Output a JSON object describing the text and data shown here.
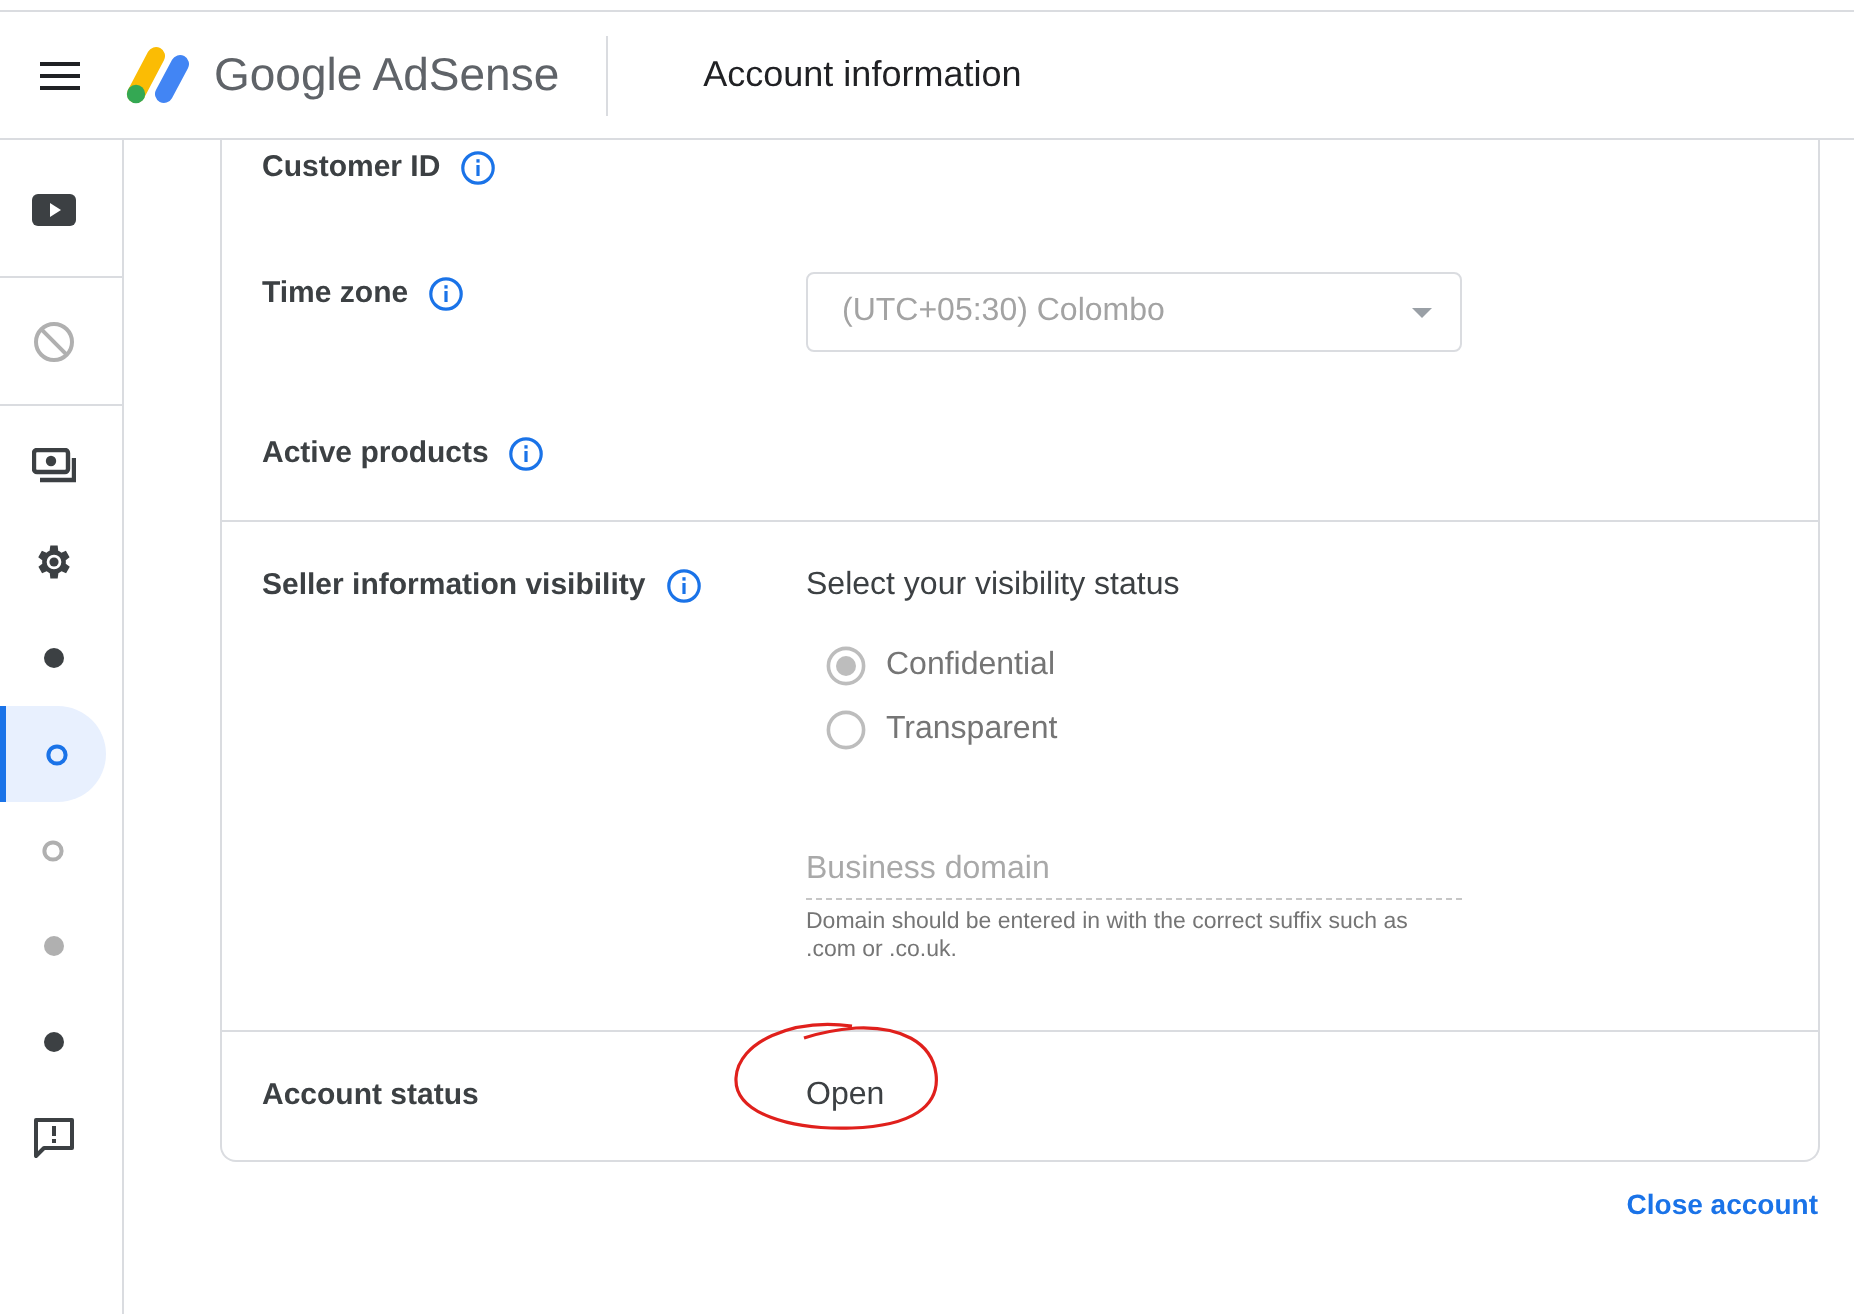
{
  "header": {
    "product": "Google AdSense",
    "page_title": "Account information"
  },
  "sidebar": {
    "items": [
      {
        "kind": "video",
        "selected": false,
        "disabled": false
      },
      {
        "kind": "blocked",
        "selected": false,
        "disabled": true
      },
      {
        "kind": "money",
        "selected": false,
        "disabled": false
      },
      {
        "kind": "settings",
        "selected": false,
        "disabled": false
      },
      {
        "kind": "dot",
        "selected": false,
        "disabled": false
      },
      {
        "kind": "ring",
        "selected": true,
        "disabled": false
      },
      {
        "kind": "ring",
        "selected": false,
        "disabled": true
      },
      {
        "kind": "dot",
        "selected": false,
        "disabled": true
      },
      {
        "kind": "dot",
        "selected": false,
        "disabled": false
      },
      {
        "kind": "feedback",
        "selected": false,
        "disabled": false
      }
    ]
  },
  "sections": [
    {
      "rows": [
        {
          "kind": "text",
          "label": "Customer ID",
          "info": true
        },
        {
          "kind": "select",
          "label": "Time zone",
          "info": true,
          "value": "(UTC+05:30) Colombo",
          "disabled": true
        },
        {
          "kind": "text",
          "label": "Active products",
          "info": true
        }
      ]
    },
    {
      "rows": [
        {
          "kind": "visibility",
          "label": "Seller information visibility",
          "info": true,
          "prompt": "Select your visibility status",
          "options": [
            {
              "label": "Confidential",
              "selected": true
            },
            {
              "label": "Transparent",
              "selected": false
            }
          ],
          "domain": {
            "placeholder": "Business domain",
            "helper": "Domain should be entered in with the correct suffix such as .com or .co.uk."
          },
          "disabled": true
        }
      ]
    },
    {
      "rows": [
        {
          "kind": "status",
          "label": "Account status",
          "info": false,
          "value": "Open",
          "circled": true
        }
      ]
    }
  ],
  "close_link": "Close account"
}
